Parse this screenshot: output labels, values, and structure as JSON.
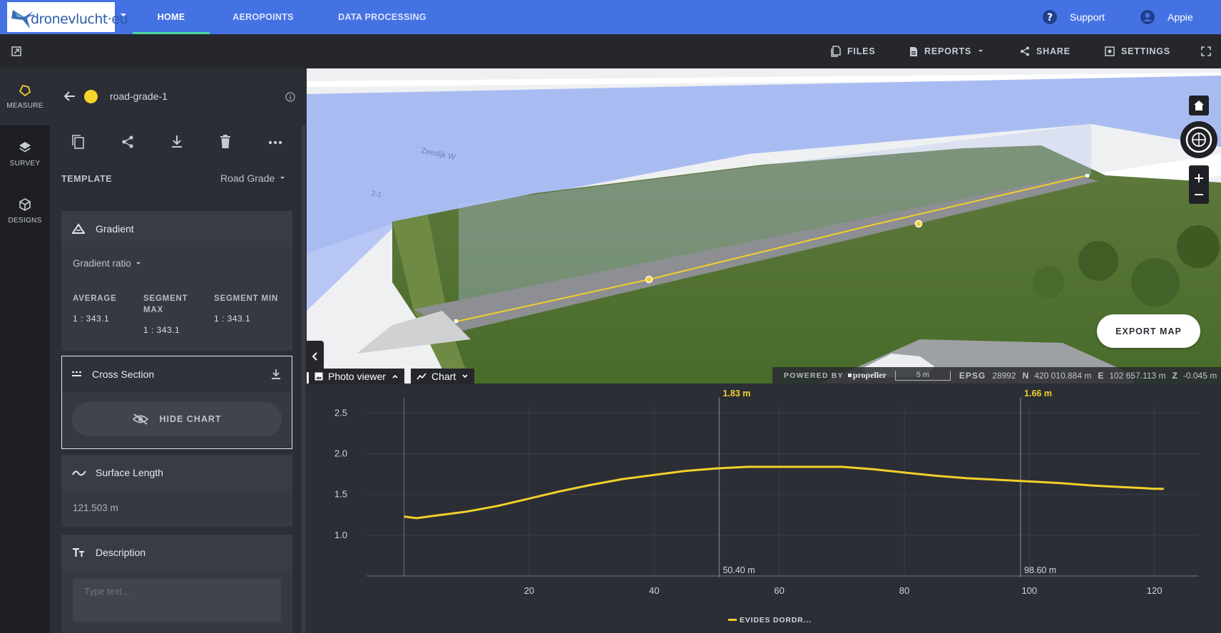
{
  "header": {
    "logo_text": "dronevlucht·eu",
    "tabs": [
      {
        "label": "HOME",
        "active": true
      },
      {
        "label": "AEROPOINTS",
        "active": false
      },
      {
        "label": "DATA PROCESSING",
        "active": false
      }
    ],
    "support_label": "Support",
    "user_label": "Appie",
    "accent_color": "#4572e3",
    "active_tab_color": "#4dd7a1"
  },
  "toolbar": {
    "files": "FILES",
    "reports": "REPORTS",
    "share": "SHARE",
    "settings": "SETTINGS"
  },
  "rail": {
    "items": [
      {
        "label": "MEASURE",
        "icon": "measure-polygon-icon",
        "active": true
      },
      {
        "label": "SURVEY",
        "icon": "layers-icon",
        "active": false
      },
      {
        "label": "DESIGNS",
        "icon": "cube-icon",
        "active": false
      }
    ]
  },
  "panel": {
    "measurement_name": "road-grade-1",
    "measurement_color": "#f6d32d",
    "template_label": "TEMPLATE",
    "template_value": "Road Grade",
    "gradient": {
      "title": "Gradient",
      "mode": "Gradient ratio",
      "stats": [
        {
          "label": "AVERAGE",
          "value": "1 : 343.1"
        },
        {
          "label": "SEGMENT MAX",
          "value": "1 : 343.1"
        },
        {
          "label": "SEGMENT MIN",
          "value": "1 : 343.1"
        }
      ]
    },
    "cross_section": {
      "title": "Cross Section",
      "hide_chart_label": "HIDE CHART"
    },
    "surface_length": {
      "title": "Surface Length",
      "value": "121.503 m"
    },
    "description": {
      "title": "Description",
      "placeholder": "Type text..."
    }
  },
  "map": {
    "export_label": "EXPORT MAP",
    "powered_by": "POWERED BY",
    "provider": "propeller",
    "scale_label": "5 m",
    "epsg_label": "EPSG",
    "epsg": "28992",
    "n_label": "N",
    "n_value": "420 010.884 m",
    "e_label": "E",
    "e_value": "102 657.113 m",
    "z_label": "Z",
    "z_value": "-0.045 m"
  },
  "chart_tabs": {
    "photo_viewer": "Photo viewer",
    "chart": "Chart"
  },
  "chart_data": {
    "type": "line",
    "title": "",
    "xlabel": "",
    "ylabel": "",
    "xlim": [
      -6,
      127
    ],
    "ylim": [
      0.5,
      2.6
    ],
    "x_ticks": [
      20,
      40,
      60,
      80,
      100,
      120
    ],
    "y_ticks": [
      1.0,
      1.5,
      2.0,
      2.5
    ],
    "grid": true,
    "legend": "bottom-center",
    "series": [
      {
        "name": "EVIDES DORDR...",
        "color": "#f2d02b",
        "x": [
          0,
          2,
          5,
          8,
          10,
          15,
          20,
          25,
          30,
          35,
          40,
          45,
          50,
          55,
          60,
          65,
          70,
          75,
          80,
          85,
          90,
          95,
          100,
          105,
          110,
          115,
          118,
          120,
          121.5
        ],
        "y": [
          1.23,
          1.21,
          1.24,
          1.27,
          1.29,
          1.36,
          1.45,
          1.54,
          1.62,
          1.69,
          1.74,
          1.79,
          1.82,
          1.84,
          1.84,
          1.84,
          1.84,
          1.81,
          1.77,
          1.73,
          1.7,
          1.68,
          1.66,
          1.64,
          1.61,
          1.59,
          1.58,
          1.57,
          1.57
        ]
      }
    ],
    "markers": [
      {
        "x": 50.4,
        "x_label": "50.40 m",
        "y_label": "1.83 m"
      },
      {
        "x": 98.6,
        "x_label": "98.60 m",
        "y_label": "1.66 m"
      }
    ]
  }
}
